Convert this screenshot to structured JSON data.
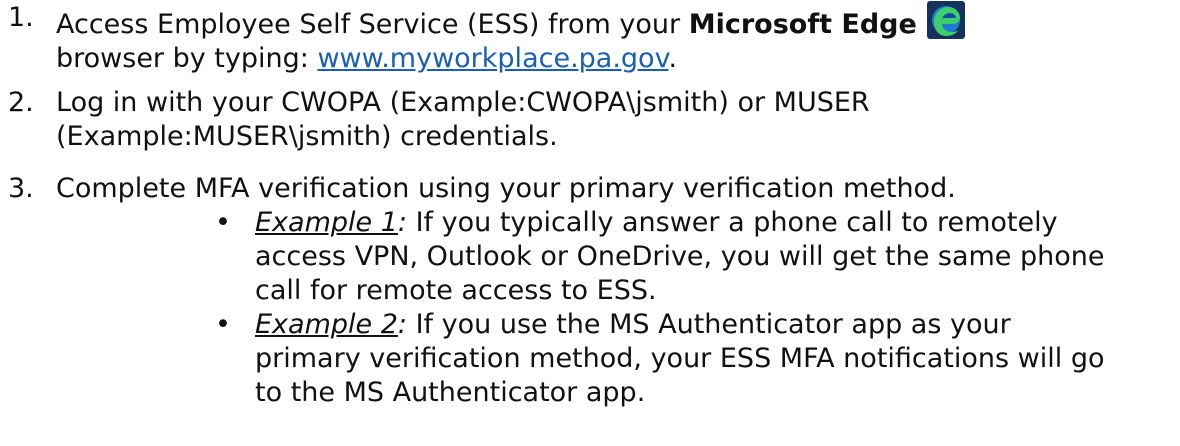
{
  "steps": [
    {
      "number": "1.",
      "lines": [
        {
          "pre": "Access Employee Self Service (ESS) from your ",
          "bold": "Microsoft Edge",
          "icon": "microsoft-edge-icon"
        },
        {
          "pre": "browser by typing: ",
          "link": "www.myworkplace.pa.gov",
          "post": "."
        }
      ]
    },
    {
      "number": "2.",
      "lines": [
        "Log in with your CWOPA (Example:CWOPA\\jsmith) or MUSER",
        "(Example:MUSER\\jsmith) credentials."
      ]
    },
    {
      "number": "3.",
      "lines": [
        "Complete MFA verification using your primary verification method."
      ]
    }
  ],
  "bullets": [
    {
      "label": "Example 1",
      "colon": ":",
      "lines": [
        " If you typically answer a phone call to remotely",
        "access VPN, Outlook or OneDrive, you will get the same phone",
        "call for remote access to ESS."
      ]
    },
    {
      "label": "Example 2",
      "colon": ":",
      "lines": [
        " If you use the MS Authenticator app as your",
        "primary verification method, your ESS MFA notifications will go",
        "to the MS Authenticator app."
      ]
    }
  ],
  "colors": {
    "text": "#111111",
    "link": "#1a5fb4",
    "edge_blue": "#1f7ad4",
    "edge_green": "#3ccf6a"
  }
}
